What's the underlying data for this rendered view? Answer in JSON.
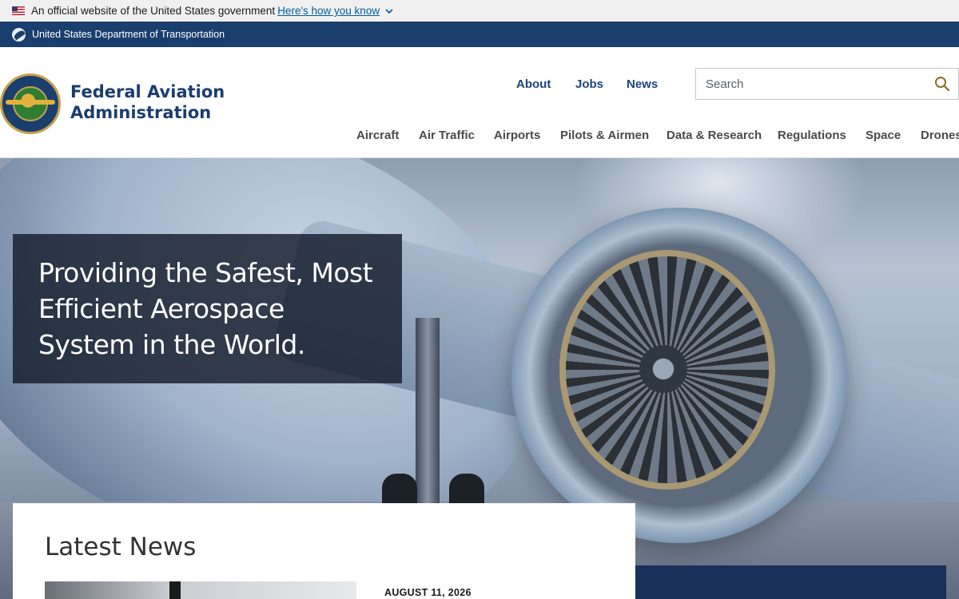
{
  "gov_banner": {
    "text": "An official website of the United States government",
    "link": "Here's how you know"
  },
  "dot_bar": {
    "text": "United States Department of Transportation"
  },
  "header": {
    "brand": "Federal Aviation Administration",
    "top_nav": [
      "About",
      "Jobs",
      "News"
    ],
    "search": {
      "placeholder": "Search"
    },
    "main_nav": [
      "Aircraft",
      "Air Traffic",
      "Airports",
      "Pilots & Airmen",
      "Data & Research",
      "Regulations",
      "Space",
      "Drones"
    ]
  },
  "hero": {
    "title": "Providing the Safest, Most Efficient Aerospace System in the World."
  },
  "news": {
    "heading": "Latest News",
    "items": [
      {
        "date": "AUGUST 11, 2026"
      }
    ]
  },
  "colors": {
    "accent": "#1a4480",
    "dot_bar": "#1a3e6e",
    "gov_banner": "#f0f0f0",
    "link": "#005ea2"
  }
}
